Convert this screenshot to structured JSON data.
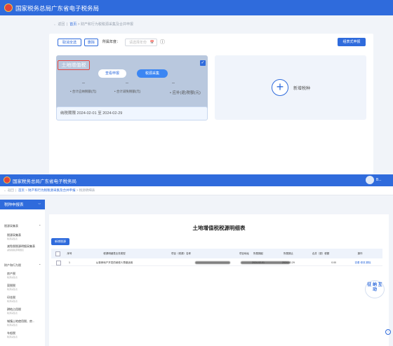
{
  "top_header": {
    "title": "国家税务总局广东省电子税务局"
  },
  "top_breadcrumb": {
    "back": "返回",
    "home": "首页",
    "sep": ">",
    "current": "财产和行为税税源采集及合并申报"
  },
  "toolbar": {
    "cancel_all": "取消全选",
    "delete": "删除",
    "period_label": "所属年度：",
    "period_placeholder": "请选择年份",
    "calendar_icon": "📅",
    "info_icon": "ⓘ",
    "combined_declare": "组表式申报"
  },
  "tax_card": {
    "title": "土地增值税",
    "view_declare": "查看申报",
    "collect_button": "税源采集",
    "metrics": [
      {
        "value": "--",
        "label": "• 合计应纳税额(元)"
      },
      {
        "value": "--",
        "label": "• 合计减免税额(元)"
      },
      {
        "value": "--",
        "label": "• 应补(退)税额(元)"
      }
    ],
    "period_text": "纳税期限 2024-02-01 至 2024-02-29",
    "check": "✓"
  },
  "add_card": {
    "plus": "+",
    "label": "新增税种"
  },
  "bottom_header": {
    "title": "国家税务总局广东省电子税务局",
    "user": "B..."
  },
  "bottom_breadcrumb": {
    "back": "返回",
    "home": "首页",
    "parent": "财产和行为税税源采集及合并申报",
    "current": "税源明细表",
    "sep": ">"
  },
  "sidebar": {
    "title": "税种申报表",
    "collapse": "⇔",
    "groups": [
      {
        "name": "税源采集表",
        "items": [
          {
            "label": "税源采集表",
            "sub": "税源采集表"
          },
          {
            "label": "减免税税源明细采集表",
            "sub": "减免税税源明细表"
          }
        ]
      },
      {
        "name": "财产和行为税",
        "items": [
          {
            "label": "房产税",
            "sub": "税源采集表"
          },
          {
            "label": "契税税",
            "sub": "税源采集表"
          },
          {
            "label": "印花税",
            "sub": "税源采集表"
          },
          {
            "label": "耕地占用税",
            "sub": "税源采集表"
          },
          {
            "label": "城镇土地使用税、房...",
            "sub": "税源采集表"
          },
          {
            "label": "车船税",
            "sub": "税源采集表"
          }
        ]
      }
    ]
  },
  "report": {
    "title": "土地增值税税源明细表",
    "add_button": "新增税源",
    "columns": [
      "",
      "序号",
      "税源明细表业务类型",
      "项目（税源）名称",
      "项目地址",
      "所属期起",
      "所属期止",
      "合并（退）税额",
      "操作"
    ],
    "rows": [
      {
        "index": "1",
        "type": "从事房地产开发的纳税人预缴适用",
        "name": "",
        "address": "",
        "start": "2024-02-01",
        "end": "2024-02-29",
        "amount": "0.00",
        "ops": [
          "查看",
          "修改",
          "删除"
        ]
      }
    ]
  },
  "float_widget": {
    "text": "征 纳 互 动"
  },
  "colors": {
    "brand": "#2f6bdc",
    "highlight": "#e5443d"
  }
}
